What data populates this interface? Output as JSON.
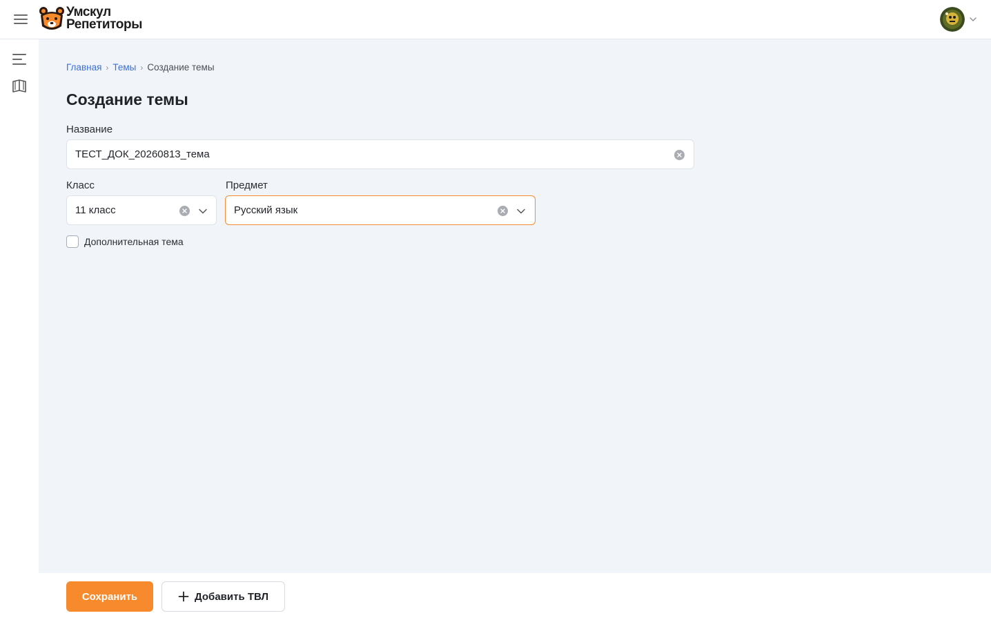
{
  "header": {
    "brand_line1": "Умскул",
    "brand_line2": "Репетиторы"
  },
  "breadcrumb": {
    "home": "Главная",
    "topics": "Темы",
    "current": "Создание темы"
  },
  "page_title": "Создание темы",
  "form": {
    "name_label": "Название",
    "name_value": "ТЕСТ_ДОК_20260813_тема",
    "class_label": "Класс",
    "class_value": "11 класс",
    "subject_label": "Предмет",
    "subject_value": "Русский язык",
    "extra_topic_label": "Дополнительная тема",
    "extra_topic_checked": false
  },
  "footer": {
    "save_label": "Сохранить",
    "add_tvl_label": "Добавить ТВЛ"
  },
  "colors": {
    "accent": "#f68a2d",
    "link": "#3b6fd8",
    "background": "#f1f5f9"
  },
  "icons": {
    "menu": "hamburger-menu-icon",
    "logo": "bear-logo-icon",
    "list": "list-icon",
    "book": "book-icon",
    "clear": "clear-circle-icon",
    "chevron": "chevron-down-icon",
    "plus": "plus-icon"
  }
}
